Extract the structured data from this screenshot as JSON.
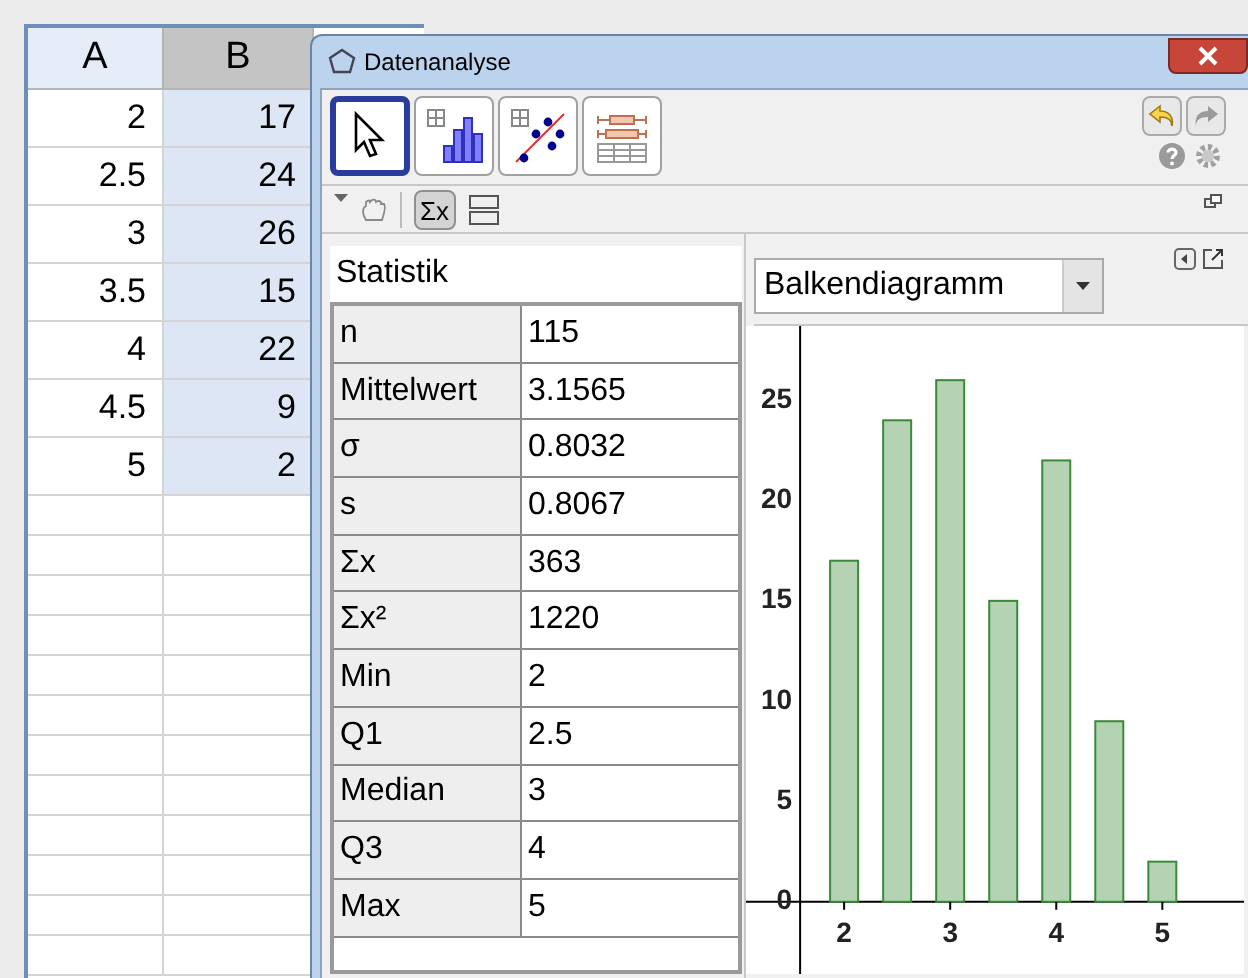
{
  "spreadsheet": {
    "columns": [
      {
        "label": "A",
        "selected": false
      },
      {
        "label": "B",
        "selected": true
      }
    ],
    "rows": [
      [
        "2",
        "17"
      ],
      [
        "2.5",
        "24"
      ],
      [
        "3",
        "26"
      ],
      [
        "3.5",
        "15"
      ],
      [
        "4",
        "22"
      ],
      [
        "4.5",
        "9"
      ],
      [
        "5",
        "2"
      ]
    ]
  },
  "window": {
    "title": "Datenanalyse"
  },
  "tools": [
    {
      "kind": "pointer",
      "selected": true
    },
    {
      "kind": "histogram",
      "selected": false
    },
    {
      "kind": "scatter",
      "selected": false
    },
    {
      "kind": "boxplot",
      "selected": false
    }
  ],
  "view_toolbar": {
    "sigma_label": "Σx",
    "sigma_pressed": true
  },
  "stat_panel": {
    "title": "Statistik",
    "rows": [
      {
        "label": "n",
        "value": "115"
      },
      {
        "label": "Mittelwert",
        "value": "3.1565"
      },
      {
        "label": "σ",
        "value": "0.8032"
      },
      {
        "label": "s",
        "value": "0.8067"
      },
      {
        "label": "Σx",
        "value": "363"
      },
      {
        "label": "Σx²",
        "value": "1220"
      },
      {
        "label": "Min",
        "value": "2"
      },
      {
        "label": "Q1",
        "value": "2.5"
      },
      {
        "label": "Median",
        "value": "3"
      },
      {
        "label": "Q3",
        "value": "4"
      },
      {
        "label": "Max",
        "value": "5"
      }
    ]
  },
  "chart_panel": {
    "chart_type": "Balkendiagramm",
    "chart_data": {
      "type": "bar",
      "x": [
        2,
        2.5,
        3,
        3.5,
        4,
        4.5,
        5
      ],
      "series": [
        {
          "color": "#b3d3b3",
          "values": [
            17,
            24,
            26,
            15,
            22,
            9,
            2
          ]
        }
      ],
      "xlim": [
        1.075,
        5.77
      ],
      "ylim": [
        -3.6,
        28.7
      ],
      "xticks": [
        2,
        3,
        4,
        5
      ],
      "yticks": [
        0,
        5,
        10,
        15,
        20,
        25
      ]
    }
  }
}
